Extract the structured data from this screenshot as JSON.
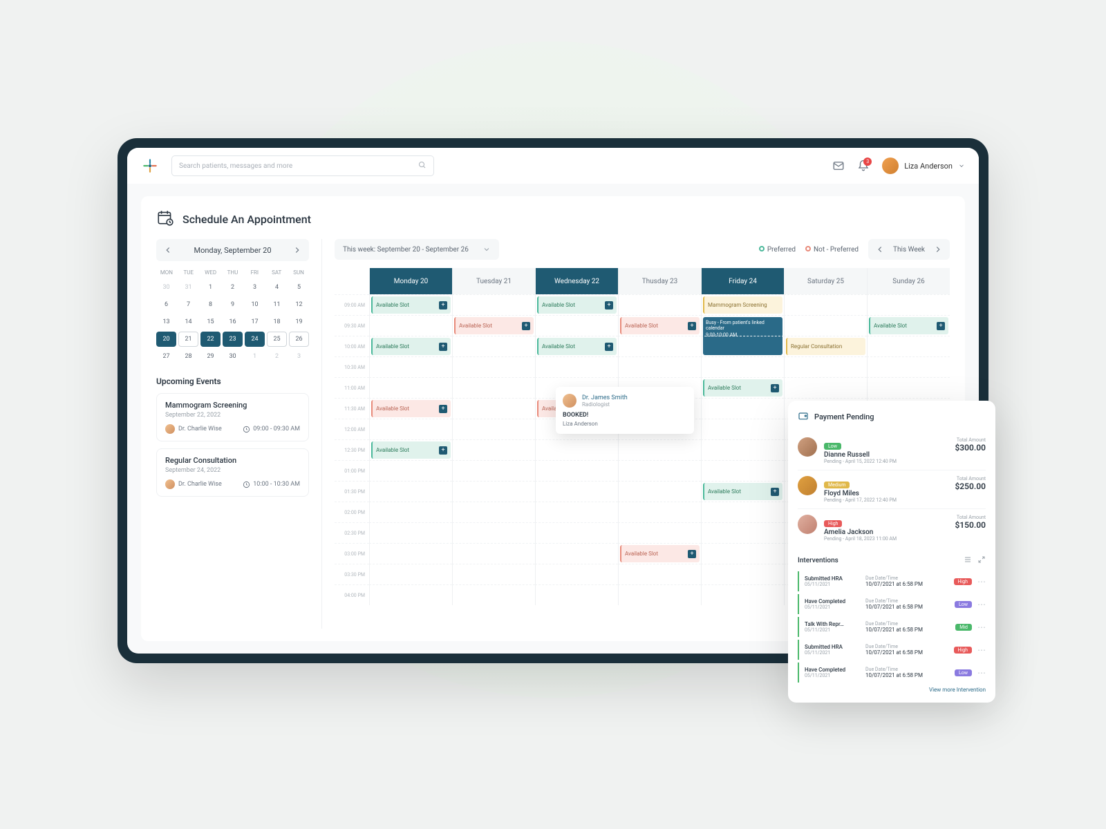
{
  "header": {
    "search_placeholder": "Search patients, messages and more",
    "notif_count": "3",
    "user_name": "Liza Anderson"
  },
  "page_title": "Schedule An Appointment",
  "date_nav": "Monday, September 20",
  "dow": [
    "MON",
    "TUE",
    "WED",
    "THU",
    "FRI",
    "SAT",
    "SUN"
  ],
  "mini_cal_rows": [
    [
      {
        "n": "30",
        "m": 1
      },
      {
        "n": "31",
        "m": 1
      },
      {
        "n": "1"
      },
      {
        "n": "2"
      },
      {
        "n": "3"
      },
      {
        "n": "4"
      },
      {
        "n": "5"
      }
    ],
    [
      {
        "n": "6"
      },
      {
        "n": "7"
      },
      {
        "n": "8"
      },
      {
        "n": "9"
      },
      {
        "n": "10"
      },
      {
        "n": "11"
      },
      {
        "n": "12"
      }
    ],
    [
      {
        "n": "13"
      },
      {
        "n": "14"
      },
      {
        "n": "15"
      },
      {
        "n": "16"
      },
      {
        "n": "17"
      },
      {
        "n": "18"
      },
      {
        "n": "19"
      }
    ],
    [
      {
        "n": "20",
        "s": 1,
        "r": 1
      },
      {
        "n": "21",
        "r": 1
      },
      {
        "n": "22",
        "s": 1
      },
      {
        "n": "23",
        "s": 1
      },
      {
        "n": "24",
        "s": 1
      },
      {
        "n": "25",
        "r": 1
      },
      {
        "n": "26",
        "r": 1
      }
    ],
    [
      {
        "n": "27"
      },
      {
        "n": "28"
      },
      {
        "n": "29"
      },
      {
        "n": "30"
      },
      {
        "n": "1",
        "m": 1
      },
      {
        "n": "2",
        "m": 1
      },
      {
        "n": "3",
        "m": 1
      }
    ]
  ],
  "upcoming_title": "Upcoming Events",
  "events": [
    {
      "title": "Mammogram Screening",
      "date": "September 22, 2022",
      "doctor": "Dr. Charlie Wise",
      "time": "09:00 - 09:30 AM"
    },
    {
      "title": "Regular Consultation",
      "date": "September 24, 2022",
      "doctor": "Dr. Charlie Wise",
      "time": "10:00 - 10:30 AM"
    }
  ],
  "week_label": "This week: September 20 - September 26",
  "legend": {
    "pref": "Preferred",
    "notpref": "Not - Preferred"
  },
  "this_week": "This Week",
  "day_heads": [
    "Monday 20",
    "Tuesday 21",
    "Wednesday 22",
    "Thusday 23",
    "Friday 24",
    "Saturday 25",
    "Sunday 26"
  ],
  "active_days": [
    0,
    2,
    4
  ],
  "time_slots": [
    "09:00 AM",
    "09:30 AM",
    "10:00 AM",
    "10:30 AM",
    "11:00 AM",
    "11:30 AM",
    "12:00 AM",
    "12:30 PM",
    "01:00 PM",
    "01:30 PM",
    "02:00 PM",
    "02:30 PM",
    "03:00 PM",
    "03:30 PM",
    "04:00 PM"
  ],
  "slot_label": "Available Slot",
  "busy_label": "Busy - From patient's linked calendar",
  "busy_time": "9:00-10:00 AM",
  "mammo_label": "Mammogram Screening",
  "regular_label": "Regular Consultation",
  "schedule": [
    {
      "r": 0,
      "c": 0,
      "k": "green"
    },
    {
      "r": 0,
      "c": 2,
      "k": "green"
    },
    {
      "r": 0,
      "c": 4,
      "k": "mammo"
    },
    {
      "r": 1,
      "c": 1,
      "k": "pink"
    },
    {
      "r": 1,
      "c": 3,
      "k": "pink"
    },
    {
      "r": 1,
      "c": 4,
      "k": "busy",
      "span": 2
    },
    {
      "r": 1,
      "c": 6,
      "k": "green"
    },
    {
      "r": 2,
      "c": 0,
      "k": "green"
    },
    {
      "r": 2,
      "c": 2,
      "k": "green"
    },
    {
      "r": 2,
      "c": 5,
      "k": "regular"
    },
    {
      "r": 4,
      "c": 4,
      "k": "green"
    },
    {
      "r": 5,
      "c": 0,
      "k": "pink"
    },
    {
      "r": 5,
      "c": 2,
      "k": "pink"
    },
    {
      "r": 7,
      "c": 0,
      "k": "green"
    },
    {
      "r": 9,
      "c": 4,
      "k": "green"
    },
    {
      "r": 12,
      "c": 3,
      "k": "pink"
    }
  ],
  "popup": {
    "doctor": "Dr. James Smith",
    "role": "Radiologist",
    "status": "BOOKED!",
    "patient": "Liza Anderson"
  },
  "payment": {
    "title": "Payment Pending",
    "rows": [
      {
        "tag": "Low",
        "cls": "tag-low",
        "name": "Dianne Russell",
        "date": "Pending - April 15, 2022 12:40 PM",
        "amount": "$300.00",
        "color": "linear-gradient(135deg,#d0a080,#a07050)"
      },
      {
        "tag": "Medium",
        "cls": "tag-med",
        "name": "Floyd Miles",
        "date": "Pending - April 17, 2022 12:40 PM",
        "amount": "$250.00",
        "color": "linear-gradient(135deg,#e0a040,#c08030)"
      },
      {
        "tag": "High",
        "cls": "tag-high",
        "name": "Amelia Jackson",
        "date": "Pending - April 18, 2023 11:00 AM",
        "amount": "$150.00",
        "color": "linear-gradient(135deg,#e0b0a0,#c08070)"
      }
    ],
    "amt_label": "Total Amount"
  },
  "interventions": {
    "title": "Interventions",
    "due_label": "Due Date/Time",
    "rows": [
      {
        "title": "Submitted HRA",
        "date": "05/11/2021",
        "due": "10/07/2021 at 6:58 PM",
        "tag": "High",
        "cls": "tag-high2"
      },
      {
        "title": "Have Completed",
        "date": "05/11/2021",
        "due": "10/07/2021 at 6:58 PM",
        "tag": "Low",
        "cls": "tag-low2"
      },
      {
        "title": "Talk With Repr…",
        "date": "05/11/2021",
        "due": "10/07/2021 at 6:58 PM",
        "tag": "Mid",
        "cls": "tag-mid2"
      },
      {
        "title": "Submitted HRA",
        "date": "05/11/2021",
        "due": "10/07/2021 at 6:58 PM",
        "tag": "High",
        "cls": "tag-high2"
      },
      {
        "title": "Have Completed",
        "date": "05/11/2021",
        "due": "10/07/2021 at 6:58 PM",
        "tag": "Low",
        "cls": "tag-low2"
      }
    ],
    "view_more": "View more Intervention"
  }
}
